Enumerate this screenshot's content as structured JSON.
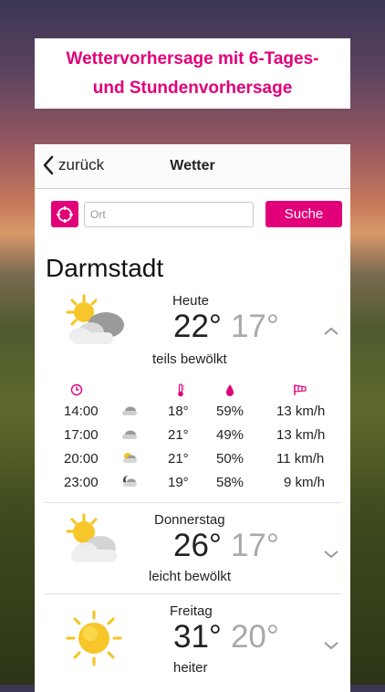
{
  "banner": {
    "line1": "Wettervorhersage mit 6-Tages-",
    "line2": "und Stundenvorhersage"
  },
  "nav": {
    "back_label": "zurück",
    "title": "Wetter"
  },
  "search": {
    "placeholder": "Ort",
    "value": "",
    "button_label": "Suche"
  },
  "city": "Darmstadt",
  "today": {
    "label": "Heute",
    "high": "22°",
    "low": "17°",
    "condition": "teils bewölkt",
    "icon": "partly-cloudy-icon"
  },
  "hourly_header_icons": [
    "clock-icon",
    "thermometer-icon",
    "raindrop-icon",
    "wind-icon"
  ],
  "hourly": [
    {
      "time": "14:00",
      "icon": "cloud-icon",
      "temp": "18°",
      "rain": "59%",
      "wind": "13 km/h"
    },
    {
      "time": "17:00",
      "icon": "cloud-icon",
      "temp": "21°",
      "rain": "49%",
      "wind": "13 km/h"
    },
    {
      "time": "20:00",
      "icon": "sun-cloud-icon",
      "temp": "21°",
      "rain": "50%",
      "wind": "11 km/h"
    },
    {
      "time": "23:00",
      "icon": "moon-cloud-icon",
      "temp": "19°",
      "rain": "58%",
      "wind": "9 km/h"
    }
  ],
  "forecast": [
    {
      "label": "Donnerstag",
      "high": "26°",
      "low": "17°",
      "condition": "leicht bewölkt",
      "icon": "sun-cloud-icon"
    },
    {
      "label": "Freitag",
      "high": "31°",
      "low": "20°",
      "condition": "heiter",
      "icon": "sun-icon"
    }
  ],
  "colors": {
    "accent": "#e2007a",
    "low_temp": "#a8a8a8"
  }
}
